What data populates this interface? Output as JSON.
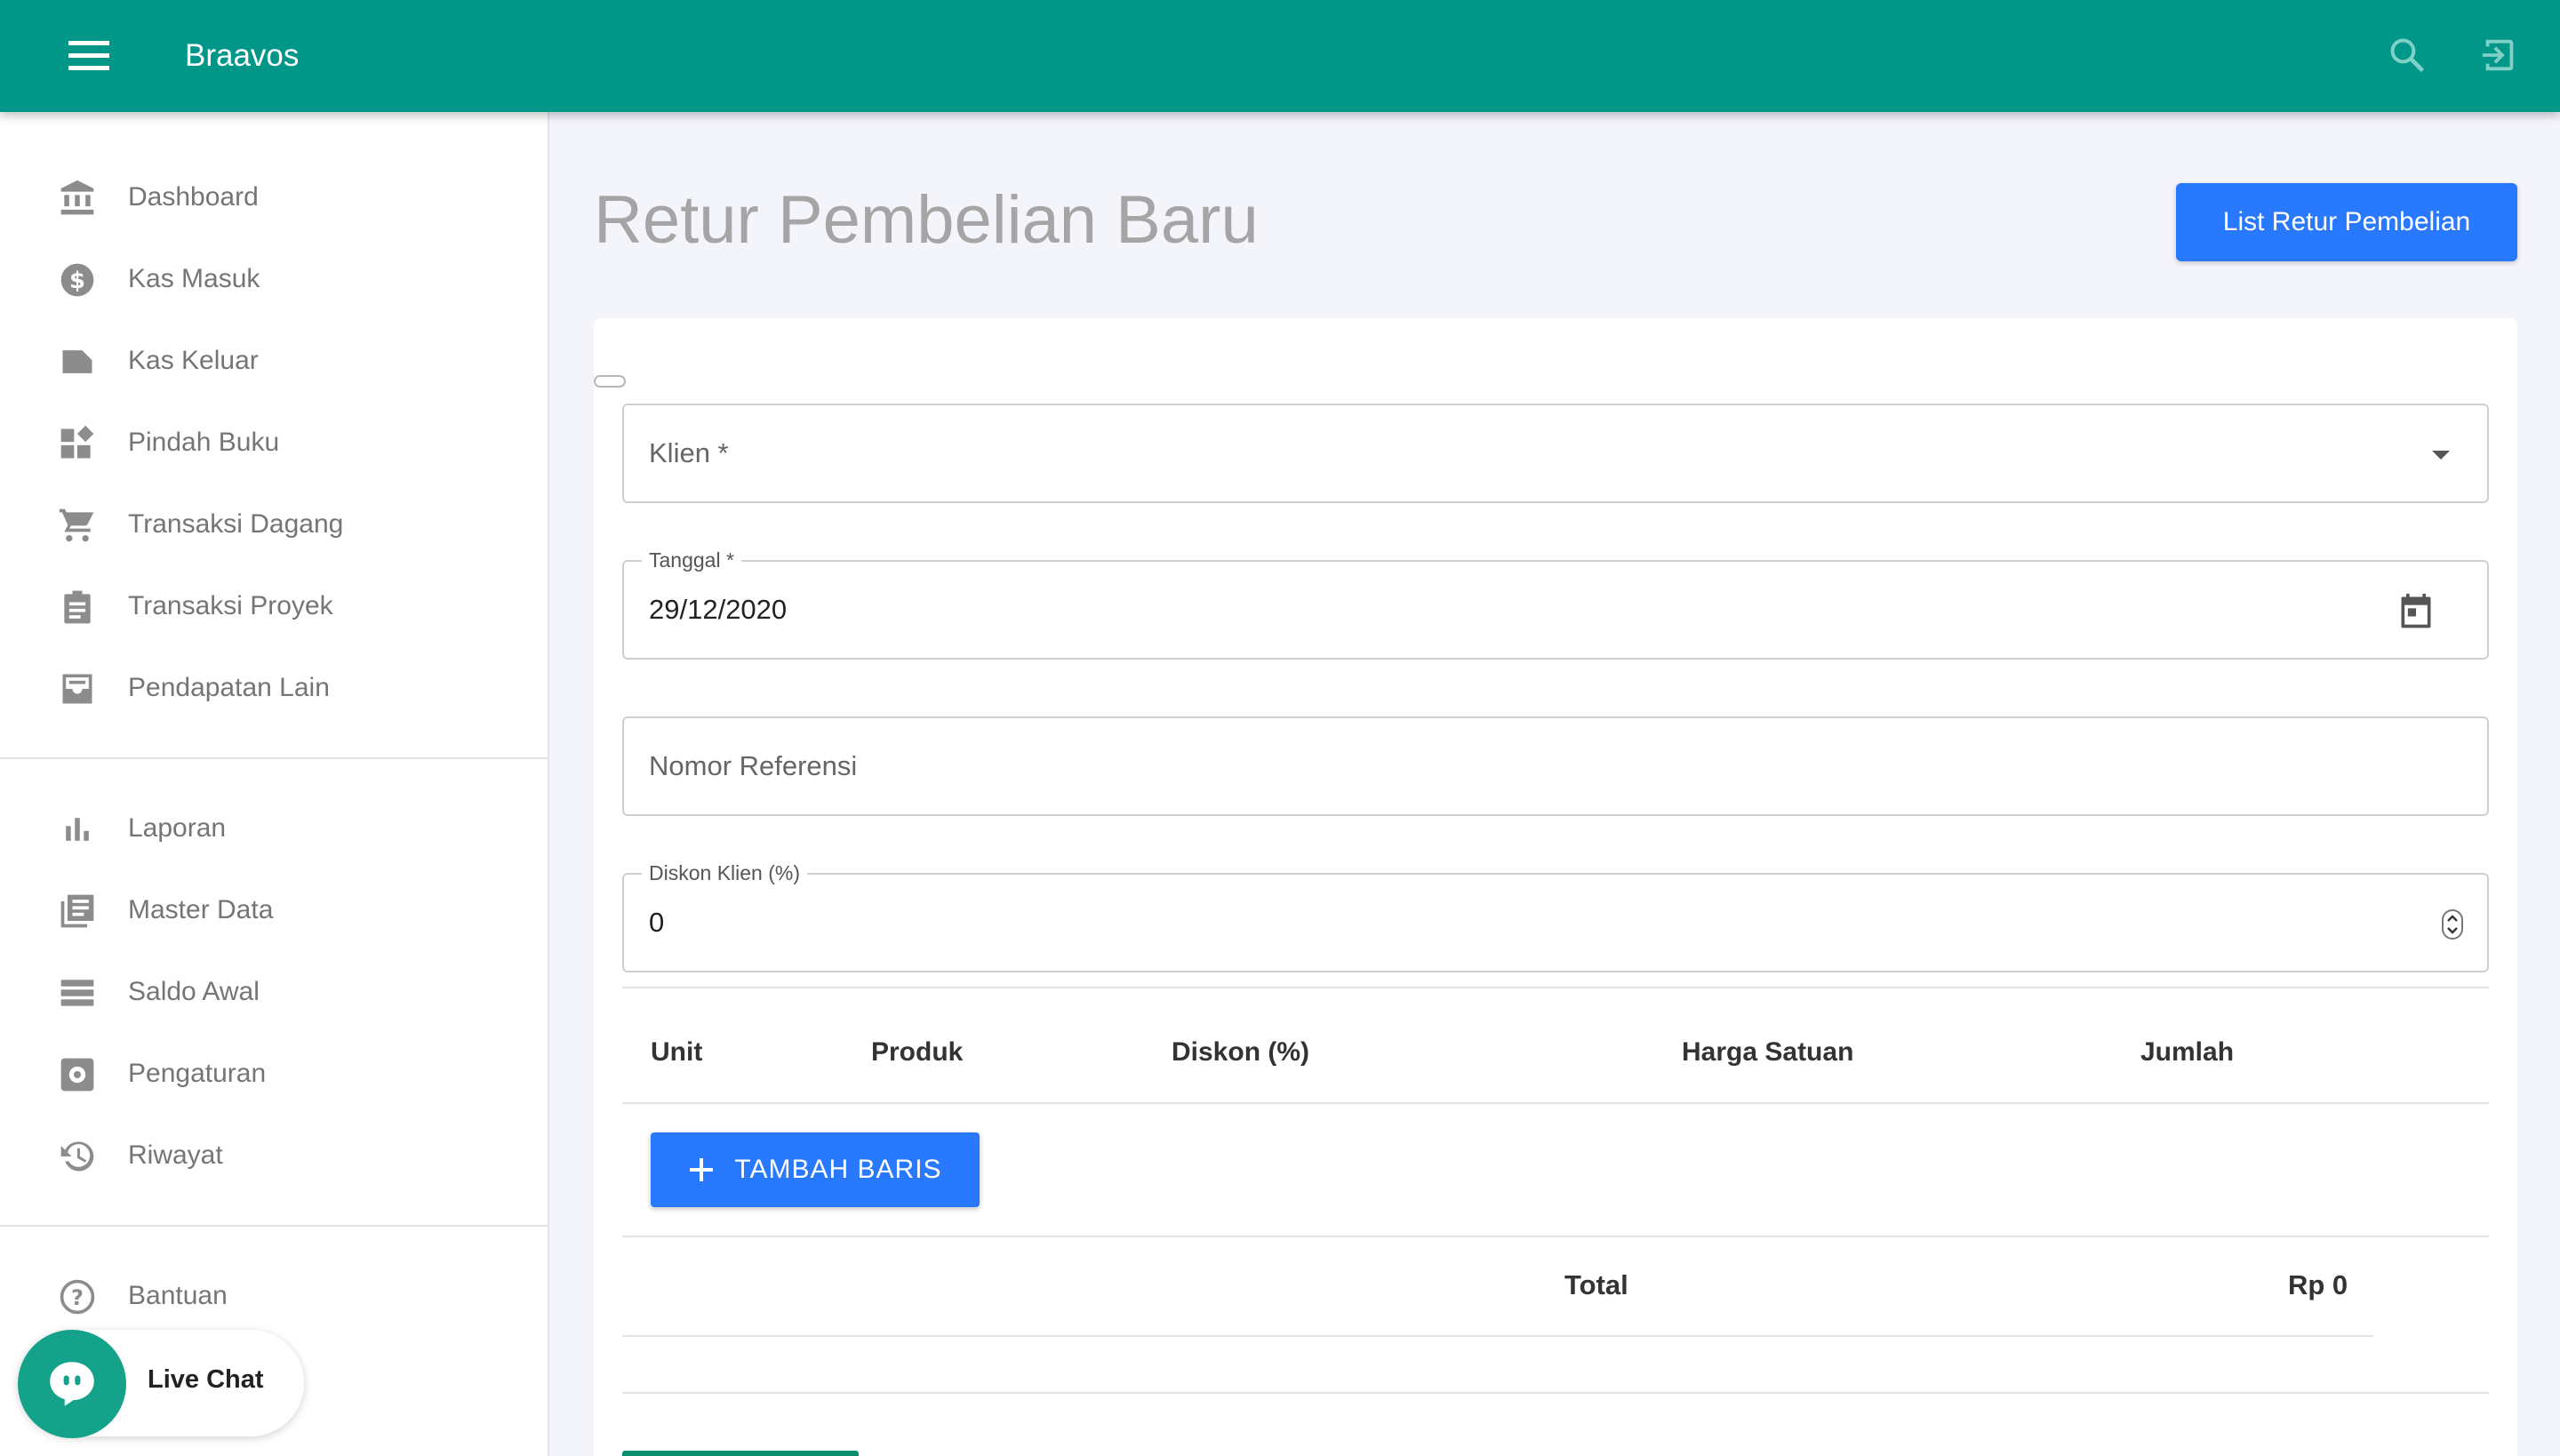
{
  "app": {
    "title": "Braavos",
    "brand_color": "#009688",
    "icons": {
      "menu": "menu-icon",
      "search": "search-icon",
      "logout": "logout-icon"
    }
  },
  "sidebar": {
    "items": [
      {
        "label": "Dashboard",
        "icon": "bank-icon"
      },
      {
        "label": "Kas Masuk",
        "icon": "dollar-circle-icon"
      },
      {
        "label": "Kas Keluar",
        "icon": "label-icon"
      },
      {
        "label": "Pindah Buku",
        "icon": "widgets-icon"
      },
      {
        "label": "Transaksi Dagang",
        "icon": "cart-icon"
      },
      {
        "label": "Transaksi Proyek",
        "icon": "clipboard-icon"
      },
      {
        "label": "Pendapatan Lain",
        "icon": "inbox-icon"
      },
      {
        "label": "Laporan",
        "icon": "bar-chart-icon"
      },
      {
        "label": "Master Data",
        "icon": "library-books-icon"
      },
      {
        "label": "Saldo Awal",
        "icon": "storage-icon"
      },
      {
        "label": "Pengaturan",
        "icon": "settings-box-icon"
      },
      {
        "label": "Riwayat",
        "icon": "history-icon"
      },
      {
        "label": "Bantuan",
        "icon": "help-circle-icon"
      }
    ]
  },
  "live_chat": {
    "label": "Live Chat",
    "color": "#14a38a"
  },
  "page": {
    "title": "Retur Pembelian Baru",
    "list_button": "List Retur Pembelian",
    "accent": "#2979ff"
  },
  "form": {
    "klien": {
      "placeholder": "Klien *"
    },
    "tanggal": {
      "label": "Tanggal *",
      "value": "29/12/2020"
    },
    "nomor_referensi": {
      "placeholder": "Nomor Referensi"
    },
    "diskon_klien": {
      "label": "Diskon Klien (%)",
      "value": "0"
    }
  },
  "table": {
    "columns": [
      "Unit",
      "Produk",
      "Diskon (%)",
      "Harga Satuan",
      "Jumlah"
    ],
    "add_row_button": "TAMBAH BARIS",
    "total_label": "Total",
    "total_value": "Rp 0"
  }
}
